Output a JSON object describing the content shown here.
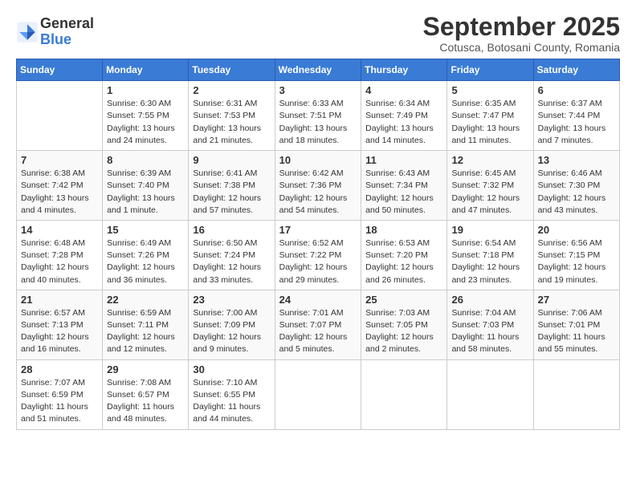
{
  "logo": {
    "general": "General",
    "blue": "Blue"
  },
  "title": "September 2025",
  "location": "Cotusca, Botosani County, Romania",
  "days_of_week": [
    "Sunday",
    "Monday",
    "Tuesday",
    "Wednesday",
    "Thursday",
    "Friday",
    "Saturday"
  ],
  "weeks": [
    [
      {
        "day": "",
        "info": ""
      },
      {
        "day": "1",
        "info": "Sunrise: 6:30 AM\nSunset: 7:55 PM\nDaylight: 13 hours\nand 24 minutes."
      },
      {
        "day": "2",
        "info": "Sunrise: 6:31 AM\nSunset: 7:53 PM\nDaylight: 13 hours\nand 21 minutes."
      },
      {
        "day": "3",
        "info": "Sunrise: 6:33 AM\nSunset: 7:51 PM\nDaylight: 13 hours\nand 18 minutes."
      },
      {
        "day": "4",
        "info": "Sunrise: 6:34 AM\nSunset: 7:49 PM\nDaylight: 13 hours\nand 14 minutes."
      },
      {
        "day": "5",
        "info": "Sunrise: 6:35 AM\nSunset: 7:47 PM\nDaylight: 13 hours\nand 11 minutes."
      },
      {
        "day": "6",
        "info": "Sunrise: 6:37 AM\nSunset: 7:44 PM\nDaylight: 13 hours\nand 7 minutes."
      }
    ],
    [
      {
        "day": "7",
        "info": "Sunrise: 6:38 AM\nSunset: 7:42 PM\nDaylight: 13 hours\nand 4 minutes."
      },
      {
        "day": "8",
        "info": "Sunrise: 6:39 AM\nSunset: 7:40 PM\nDaylight: 13 hours\nand 1 minute."
      },
      {
        "day": "9",
        "info": "Sunrise: 6:41 AM\nSunset: 7:38 PM\nDaylight: 12 hours\nand 57 minutes."
      },
      {
        "day": "10",
        "info": "Sunrise: 6:42 AM\nSunset: 7:36 PM\nDaylight: 12 hours\nand 54 minutes."
      },
      {
        "day": "11",
        "info": "Sunrise: 6:43 AM\nSunset: 7:34 PM\nDaylight: 12 hours\nand 50 minutes."
      },
      {
        "day": "12",
        "info": "Sunrise: 6:45 AM\nSunset: 7:32 PM\nDaylight: 12 hours\nand 47 minutes."
      },
      {
        "day": "13",
        "info": "Sunrise: 6:46 AM\nSunset: 7:30 PM\nDaylight: 12 hours\nand 43 minutes."
      }
    ],
    [
      {
        "day": "14",
        "info": "Sunrise: 6:48 AM\nSunset: 7:28 PM\nDaylight: 12 hours\nand 40 minutes."
      },
      {
        "day": "15",
        "info": "Sunrise: 6:49 AM\nSunset: 7:26 PM\nDaylight: 12 hours\nand 36 minutes."
      },
      {
        "day": "16",
        "info": "Sunrise: 6:50 AM\nSunset: 7:24 PM\nDaylight: 12 hours\nand 33 minutes."
      },
      {
        "day": "17",
        "info": "Sunrise: 6:52 AM\nSunset: 7:22 PM\nDaylight: 12 hours\nand 29 minutes."
      },
      {
        "day": "18",
        "info": "Sunrise: 6:53 AM\nSunset: 7:20 PM\nDaylight: 12 hours\nand 26 minutes."
      },
      {
        "day": "19",
        "info": "Sunrise: 6:54 AM\nSunset: 7:18 PM\nDaylight: 12 hours\nand 23 minutes."
      },
      {
        "day": "20",
        "info": "Sunrise: 6:56 AM\nSunset: 7:15 PM\nDaylight: 12 hours\nand 19 minutes."
      }
    ],
    [
      {
        "day": "21",
        "info": "Sunrise: 6:57 AM\nSunset: 7:13 PM\nDaylight: 12 hours\nand 16 minutes."
      },
      {
        "day": "22",
        "info": "Sunrise: 6:59 AM\nSunset: 7:11 PM\nDaylight: 12 hours\nand 12 minutes."
      },
      {
        "day": "23",
        "info": "Sunrise: 7:00 AM\nSunset: 7:09 PM\nDaylight: 12 hours\nand 9 minutes."
      },
      {
        "day": "24",
        "info": "Sunrise: 7:01 AM\nSunset: 7:07 PM\nDaylight: 12 hours\nand 5 minutes."
      },
      {
        "day": "25",
        "info": "Sunrise: 7:03 AM\nSunset: 7:05 PM\nDaylight: 12 hours\nand 2 minutes."
      },
      {
        "day": "26",
        "info": "Sunrise: 7:04 AM\nSunset: 7:03 PM\nDaylight: 11 hours\nand 58 minutes."
      },
      {
        "day": "27",
        "info": "Sunrise: 7:06 AM\nSunset: 7:01 PM\nDaylight: 11 hours\nand 55 minutes."
      }
    ],
    [
      {
        "day": "28",
        "info": "Sunrise: 7:07 AM\nSunset: 6:59 PM\nDaylight: 11 hours\nand 51 minutes."
      },
      {
        "day": "29",
        "info": "Sunrise: 7:08 AM\nSunset: 6:57 PM\nDaylight: 11 hours\nand 48 minutes."
      },
      {
        "day": "30",
        "info": "Sunrise: 7:10 AM\nSunset: 6:55 PM\nDaylight: 11 hours\nand 44 minutes."
      },
      {
        "day": "",
        "info": ""
      },
      {
        "day": "",
        "info": ""
      },
      {
        "day": "",
        "info": ""
      },
      {
        "day": "",
        "info": ""
      }
    ]
  ]
}
